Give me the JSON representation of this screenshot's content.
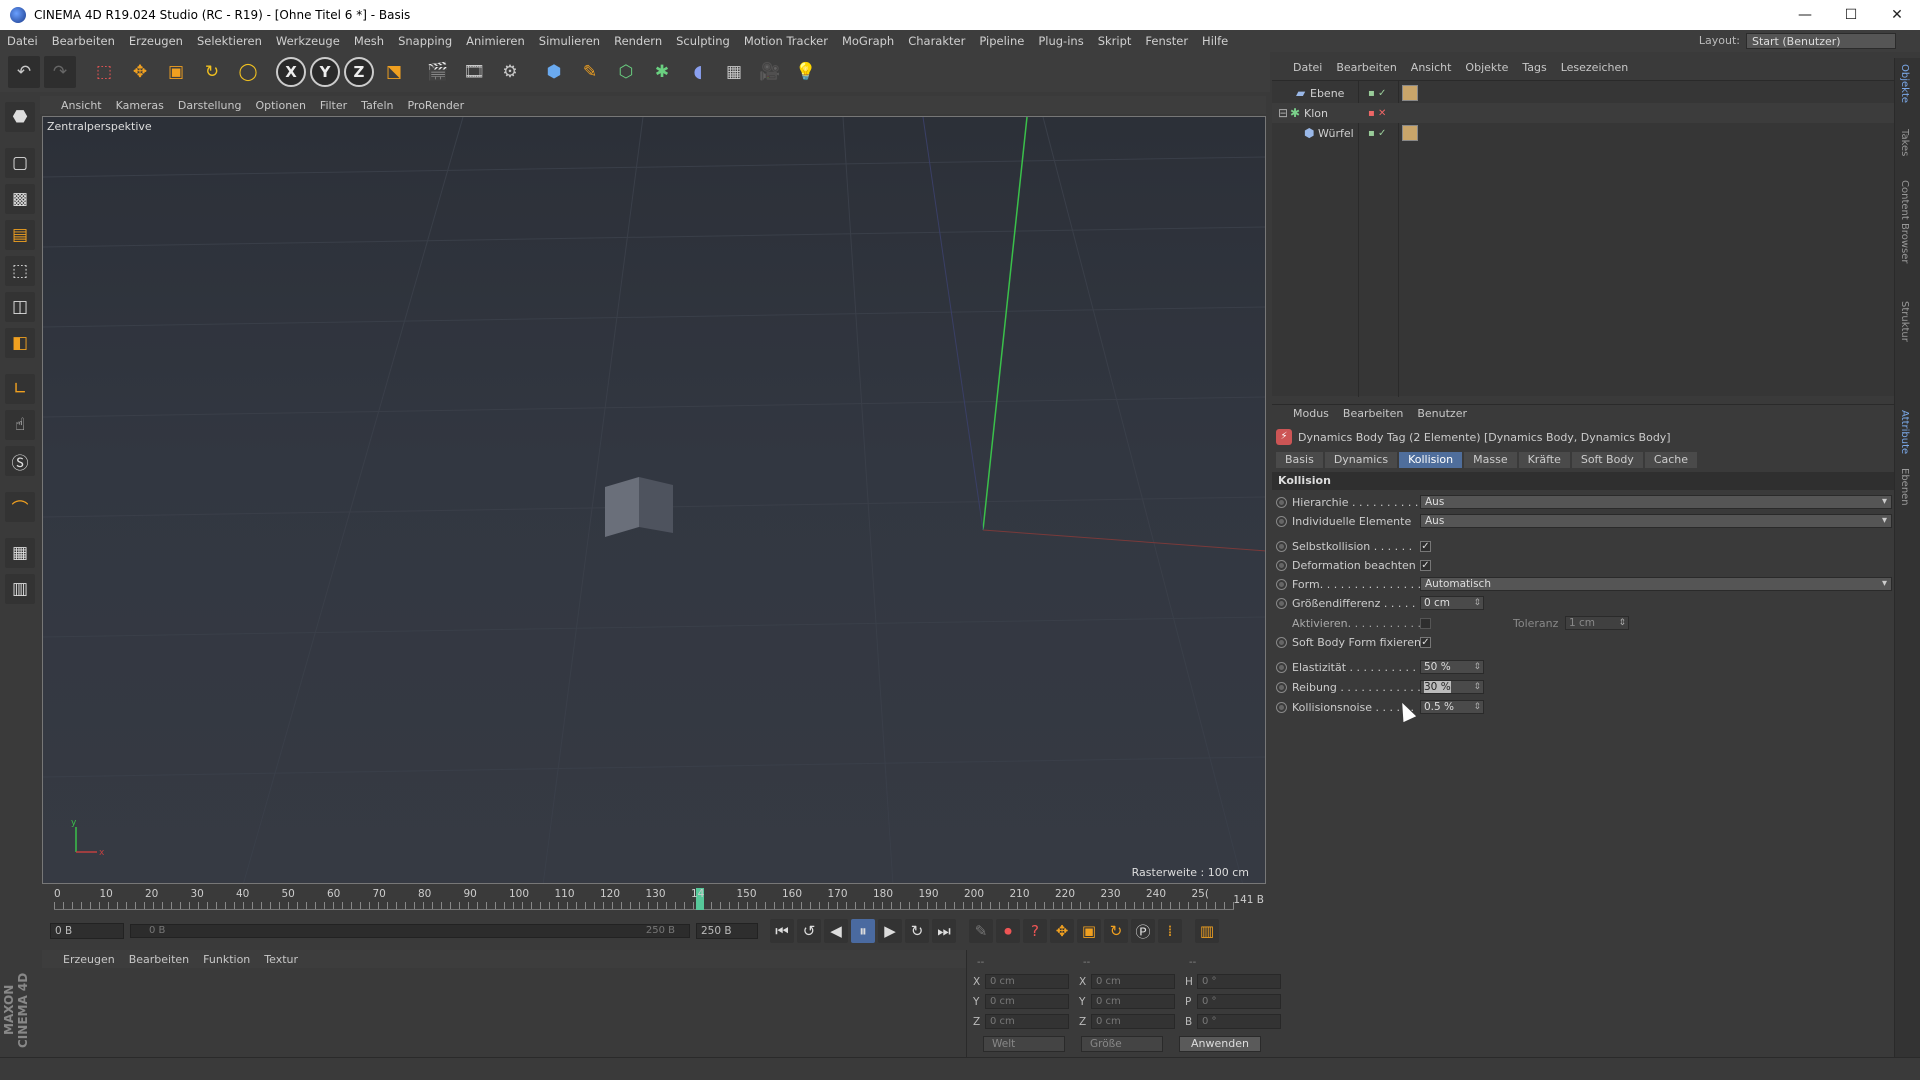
{
  "window": {
    "title": "CINEMA 4D R19.024 Studio (RC - R19) - [Ohne Titel 6 *] - Basis",
    "minimize": "—",
    "maximize": "☐",
    "close": "✕"
  },
  "menubar": [
    "Datei",
    "Bearbeiten",
    "Erzeugen",
    "Selektieren",
    "Werkzeuge",
    "Mesh",
    "Snapping",
    "Animieren",
    "Simulieren",
    "Rendern",
    "Sculpting",
    "Motion Tracker",
    "MoGraph",
    "Charakter",
    "Pipeline",
    "Plug-ins",
    "Skript",
    "Fenster",
    "Hilfe"
  ],
  "layout": {
    "label": "Layout:",
    "value": "Start (Benutzer)"
  },
  "viewport": {
    "menu": [
      "Ansicht",
      "Kameras",
      "Darstellung",
      "Optionen",
      "Filter",
      "Tafeln",
      "ProRender"
    ],
    "label": "Zentralperspektive",
    "raster": "Rasterweite : 100 cm"
  },
  "timeline": {
    "labels": [
      "0",
      "10",
      "20",
      "30",
      "40",
      "50",
      "60",
      "70",
      "80",
      "90",
      "100",
      "110",
      "120",
      "130",
      "14",
      "150",
      "160",
      "170",
      "180",
      "190",
      "200",
      "210",
      "220",
      "230",
      "240",
      "25("
    ],
    "current_frame": "141 B",
    "current_frame_value": 141
  },
  "transport": {
    "start_field": "0 B",
    "range_start": "0 B",
    "range_end": "250 B",
    "end_field": "250 B"
  },
  "material_menu": [
    "Erzeugen",
    "Bearbeiten",
    "Funktion",
    "Textur"
  ],
  "coordinates": {
    "header": [
      "--",
      "--",
      "--"
    ],
    "rows": [
      {
        "a": "X",
        "v1": "0 cm",
        "b": "X",
        "v2": "0 cm",
        "c": "H",
        "v3": "0 °"
      },
      {
        "a": "Y",
        "v1": "0 cm",
        "b": "Y",
        "v2": "0 cm",
        "c": "P",
        "v3": "0 °"
      },
      {
        "a": "Z",
        "v1": "0 cm",
        "b": "Z",
        "v2": "0 cm",
        "c": "B",
        "v3": "0 °"
      }
    ],
    "mode1": "Welt",
    "mode2": "Größe",
    "apply": "Anwenden"
  },
  "brand": "MAXON CINEMA 4D",
  "object_manager": {
    "menu": [
      "Datei",
      "Bearbeiten",
      "Ansicht",
      "Objekte",
      "Tags",
      "Lesezeichen"
    ],
    "objects": [
      {
        "name": "Ebene"
      },
      {
        "name": "Klon"
      },
      {
        "name": "Würfel"
      }
    ]
  },
  "attributes": {
    "menu": [
      "Modus",
      "Bearbeiten",
      "Benutzer"
    ],
    "header": "Dynamics Body Tag (2 Elemente) [Dynamics Body, Dynamics Body]",
    "tabs": [
      "Basis",
      "Dynamics",
      "Kollision",
      "Masse",
      "Kräfte",
      "Soft Body",
      "Cache"
    ],
    "active_tab": "Kollision",
    "section": "Kollision",
    "hierarchie": {
      "label": "Hierarchie . . . . . . . . . . .",
      "value": "Aus"
    },
    "individuelle": {
      "label": "Individuelle Elemente",
      "value": "Aus"
    },
    "selbstkollision": {
      "label": "Selbstkollision . . . . . .",
      "checked": "✓"
    },
    "deformation": {
      "label": "Deformation beachten",
      "checked": "✓"
    },
    "form": {
      "label": "Form. . . . . . . . . . . . . . . .",
      "value": "Automatisch"
    },
    "groessendifferenz": {
      "label": "Größendifferenz . . . . . .",
      "value": "0 cm"
    },
    "aktivieren": {
      "label": "Aktivieren. . . . . . . . . . ."
    },
    "toleranz": {
      "label": "Toleranz",
      "value": "1 cm"
    },
    "softbody": {
      "label": "Soft Body Form fixieren",
      "checked": "✓"
    },
    "elastizitaet": {
      "label": "Elastizität . . . . . . . . . . .",
      "value": "50 %"
    },
    "reibung": {
      "label": "Reibung . . . . . . . . . . . . .",
      "value": "30 %"
    },
    "kollisionsnoise": {
      "label": "Kollisionsnoise . . . . . .",
      "value": "0.5 %"
    }
  },
  "right_tabs": [
    "Objekte",
    "Takes",
    "Content Browser",
    "Struktur",
    "Attribute",
    "Ebenen"
  ]
}
